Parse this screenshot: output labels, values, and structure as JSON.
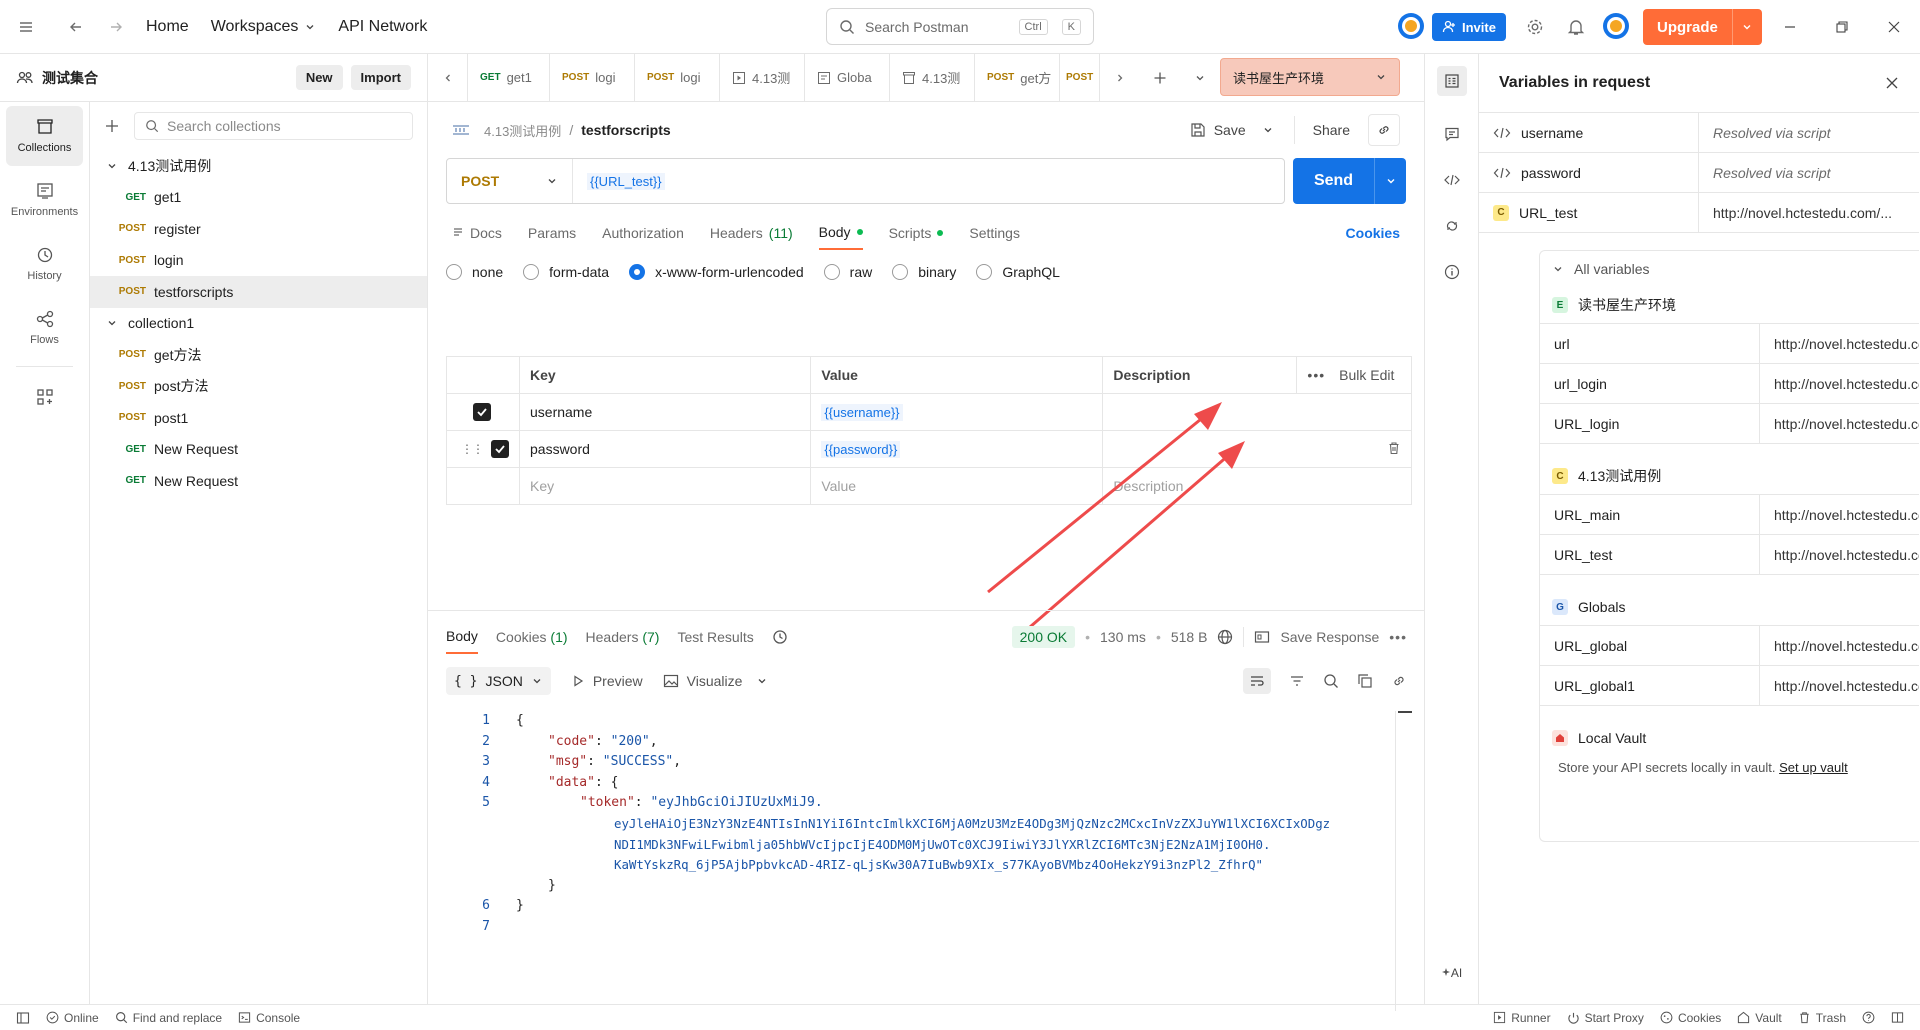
{
  "topbar": {
    "nav": {
      "home": "Home",
      "workspaces": "Workspaces",
      "api_network": "API Network"
    },
    "search": {
      "placeholder": "Search Postman",
      "shortcut_mod": "Ctrl",
      "shortcut_key": "K"
    },
    "invite": "Invite",
    "upgrade": "Upgrade"
  },
  "workspace": {
    "name": "测试集合",
    "new": "New",
    "import": "Import"
  },
  "rail": [
    {
      "label": "Collections",
      "icon": "collections-icon"
    },
    {
      "label": "Environments",
      "icon": "environments-icon"
    },
    {
      "label": "History",
      "icon": "history-icon"
    },
    {
      "label": "Flows",
      "icon": "flows-icon"
    }
  ],
  "sidebar": {
    "search_placeholder": "Search collections",
    "collections": [
      {
        "name": "4.13测试用例",
        "requests": [
          {
            "method": "GET",
            "name": "get1"
          },
          {
            "method": "POST",
            "name": "register"
          },
          {
            "method": "POST",
            "name": "login"
          },
          {
            "method": "POST",
            "name": "testforscripts"
          }
        ]
      },
      {
        "name": "collection1",
        "requests": [
          {
            "method": "POST",
            "name": "get方法"
          },
          {
            "method": "POST",
            "name": "post方法"
          },
          {
            "method": "POST",
            "name": "post1"
          },
          {
            "method": "GET",
            "name": "New Request"
          },
          {
            "method": "GET",
            "name": "New Request"
          }
        ]
      }
    ]
  },
  "tabs": [
    {
      "method": "GET",
      "name": "get1"
    },
    {
      "method": "POST",
      "name": "logi"
    },
    {
      "method": "POST",
      "name": "logi"
    },
    {
      "method": "",
      "name": "4.13测"
    },
    {
      "method": "",
      "name": "Globa"
    },
    {
      "method": "",
      "name": "4.13测"
    },
    {
      "method": "POST",
      "name": "get方"
    },
    {
      "method": "POST",
      "name": ""
    }
  ],
  "environment": "读书屋生产环境",
  "request": {
    "breadcrumb_parent": "4.13测试用例",
    "separator": "/",
    "name": "testforscripts",
    "save": "Save",
    "share": "Share",
    "method": "POST",
    "url": "{{URL_test}}",
    "send": "Send",
    "subtabs": {
      "docs": "Docs",
      "params": "Params",
      "authorization": "Authorization",
      "headers": "Headers",
      "headers_count": "(11)",
      "body": "Body",
      "scripts": "Scripts",
      "settings": "Settings"
    },
    "cookies": "Cookies",
    "body_types": [
      "none",
      "form-data",
      "x-www-form-urlencoded",
      "raw",
      "binary",
      "GraphQL"
    ],
    "table": {
      "headers": {
        "key": "Key",
        "value": "Value",
        "description": "Description",
        "bulk_edit": "Bulk Edit"
      },
      "rows": [
        {
          "key": "username",
          "value": "{{username}}"
        },
        {
          "key": "password",
          "value": "{{password}}"
        }
      ],
      "placeholders": {
        "key": "Key",
        "value": "Value",
        "description": "Description"
      }
    }
  },
  "response": {
    "tabs": {
      "body": "Body",
      "cookies": "Cookies",
      "cookies_count": "(1)",
      "headers": "Headers",
      "headers_count": "(7)",
      "test_results": "Test Results"
    },
    "status": "200 OK",
    "sep": "•",
    "time": "130 ms",
    "size": "518 B",
    "save_response": "Save Response",
    "format": "JSON",
    "preview": "Preview",
    "visualize": "Visualize",
    "code": {
      "lines": [
        "1",
        "2",
        "3",
        "4",
        "5",
        "6",
        "7"
      ],
      "open": "{",
      "close": "}",
      "code_key": "\"code\"",
      "code_val": "\"200\"",
      "msg_key": "\"msg\"",
      "msg_val": "\"SUCCESS\"",
      "data_key": "\"data\"",
      "token_key": "\"token\"",
      "token_l1": "\"eyJhbGciOiJIUzUxMiJ9.",
      "token_l2": "eyJleHAiOjE3NzY3NzE4NTIsInN1YiI6IntcImlkXCI6MjA0MzU3MzE4ODg3MjQzNzc2MCxcInVzZXJuYW1lXCI6XCIxODgz",
      "token_l3": "NDI1MDk3NFwiLFwibmlja05hbWVcIjpcIjE4ODM0MjUwOTc0XCJ9IiwiY3JlYXRlZCI6MTc3NjE2NzA1MjI0OH0.",
      "token_l4": "KaWtYskzRq_6jP5AjbPpbvkcAD-4RIZ-qLjsKw30A7IuBwb9XIx_s77KAyoBVMbz4OoHekzY9i3nzPl2_ZfhrQ\"",
      "colon": ": ",
      "comma": ","
    }
  },
  "variables_panel": {
    "title": "Variables in request",
    "in_request": [
      {
        "badge": "",
        "name": "username",
        "value": "Resolved via script"
      },
      {
        "badge": "",
        "name": "password",
        "value": "Resolved via script"
      },
      {
        "badge": "C",
        "name": "URL_test",
        "value": "http://novel.hctestedu.com/..."
      }
    ],
    "all_variables": "All variables",
    "groups": [
      {
        "badge": "E",
        "name": "读书屋生产环境",
        "vars": [
          {
            "name": "url",
            "value": "http://novel.hctestedu.com"
          },
          {
            "name": "url_login",
            "value": "http://novel.hctestedu.com..."
          },
          {
            "name": "URL_login",
            "value": "http://novel.hctestedu.com..."
          }
        ]
      },
      {
        "badge": "C",
        "name": "4.13测试用例",
        "vars": [
          {
            "name": "URL_main",
            "value": "http://novel.hctestedu.com..."
          },
          {
            "name": "URL_test",
            "value": "http://novel.hctestedu.com..."
          }
        ]
      },
      {
        "badge": "G",
        "name": "Globals",
        "vars": [
          {
            "name": "URL_global",
            "value": "http://novel.hctestedu.com..."
          },
          {
            "name": "URL_global1",
            "value": "http://novel.hctestedu.com..."
          }
        ]
      }
    ],
    "vault_title": "Local Vault",
    "vault_text": "Store your API secrets locally in vault.",
    "vault_link": "Set up vault",
    "ai_label": "AI"
  },
  "statusbar": {
    "online": "Online",
    "find_replace": "Find and replace",
    "console": "Console",
    "runner": "Runner",
    "start_proxy": "Start Proxy",
    "cookies": "Cookies",
    "vault": "Vault",
    "trash": "Trash"
  },
  "colors": {
    "accent": "#ff6c37",
    "primary": "#1473e6",
    "get": "#0a7b35",
    "post": "#ad7a03",
    "arrow": "#ee4b4b"
  }
}
